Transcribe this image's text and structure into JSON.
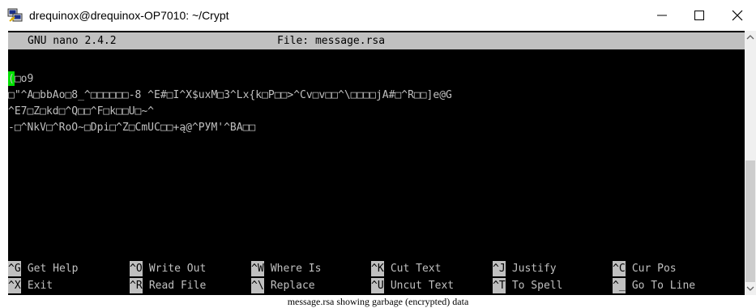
{
  "window": {
    "title": "drequinox@drequinox-OP7010: ~/Crypt",
    "minimize_glyph": "–",
    "maximize_glyph": "☐",
    "close_glyph": "✕"
  },
  "nano": {
    "version": "GNU nano 2.4.2",
    "file_label": "File: message.rsa"
  },
  "content_lines": [
    "(□o9",
    "□\"^A□bbAo□8_^□□□□□□-8 ^E#□I^X$uxM□3^Lx{k□P□□>^Cv□v□□^\\□□□□jA#□^R□□]e@G",
    "^E7□Z□kd□^Q□□^F□k□□U□~^",
    "-□^NkV□^RoO~□Dpi□^Z□CmUC□□+ą@^PУM'^BA□□"
  ],
  "shortcuts_row1": [
    {
      "key": "^G",
      "label": "Get Help"
    },
    {
      "key": "^O",
      "label": "Write Out"
    },
    {
      "key": "^W",
      "label": "Where Is"
    },
    {
      "key": "^K",
      "label": "Cut Text"
    },
    {
      "key": "^J",
      "label": "Justify"
    },
    {
      "key": "^C",
      "label": "Cur Pos"
    }
  ],
  "shortcuts_row2": [
    {
      "key": "^X",
      "label": "Exit"
    },
    {
      "key": "^R",
      "label": "Read File"
    },
    {
      "key": "^\\",
      "label": "Replace"
    },
    {
      "key": "^U",
      "label": "Uncut Text"
    },
    {
      "key": "^T",
      "label": "To Spell"
    },
    {
      "key": "^_",
      "label": "Go To Line"
    }
  ],
  "caption": "message.rsa showing garbage (encrypted) data",
  "colors": {
    "terminal_bg": "#000000",
    "terminal_fg": "#c0c0c0",
    "cursor": "#00e000",
    "titlebar_bg": "#ffffff"
  },
  "icons": {
    "app": "putty-icon",
    "scroll_up": "chevron-up-icon",
    "scroll_down": "chevron-down-icon"
  }
}
